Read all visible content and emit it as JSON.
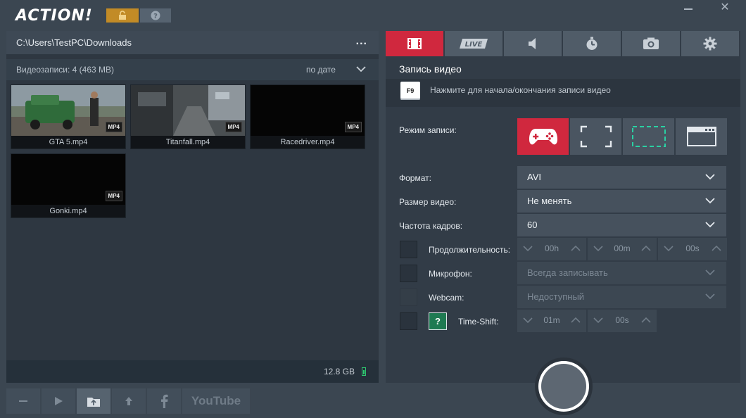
{
  "app": {
    "logo": "ACTION!"
  },
  "left": {
    "path": "C:\\Users\\TestPC\\Downloads",
    "more": "...",
    "count_label": "Видеозаписи: 4 (463 MB)",
    "sort_label": "по дате",
    "files": [
      {
        "name": "GTA 5.mp4",
        "badge": "MP4"
      },
      {
        "name": "Titanfall.mp4",
        "badge": "MP4"
      },
      {
        "name": "Racedriver.mp4",
        "badge": "MP4"
      },
      {
        "name": "Gonki.mp4",
        "badge": "MP4"
      }
    ],
    "disk_free": "12.8 GB"
  },
  "toolbar": {
    "youtube_label": "YouTube"
  },
  "tabs": [
    {
      "name": "video-tab",
      "icon": "film-icon"
    },
    {
      "name": "live-tab",
      "label": "LIVE"
    },
    {
      "name": "audio-tab",
      "icon": "speaker-icon"
    },
    {
      "name": "benchmark-tab",
      "icon": "stopwatch-icon"
    },
    {
      "name": "screenshot-tab",
      "icon": "camera-icon"
    },
    {
      "name": "settings-tab",
      "icon": "gear-icon"
    }
  ],
  "video": {
    "title": "Запись видео",
    "hotkey": "F9",
    "hotkey_hint": "Нажмите для начала/окончания записи видео",
    "mode_label": "Режим записи:",
    "format_label": "Формат:",
    "format_value": "AVI",
    "size_label": "Размер видео:",
    "size_value": "Не менять",
    "fps_label": "Частота кадров:",
    "fps_value": "60",
    "duration_label": "Продолжительность:",
    "duration_h": "00h",
    "duration_m": "00m",
    "duration_s": "00s",
    "mic_label": "Микрофон:",
    "mic_value": "Всегда записывать",
    "webcam_label": "Webcam:",
    "webcam_value": "Недоступный",
    "help_mark": "?",
    "timeshift_label": "Time-Shift:",
    "timeshift_m": "01m",
    "timeshift_s": "00s"
  },
  "colors": {
    "accent": "#d0283e",
    "lock": "#c28b26",
    "help_green": "#1f7a52"
  }
}
